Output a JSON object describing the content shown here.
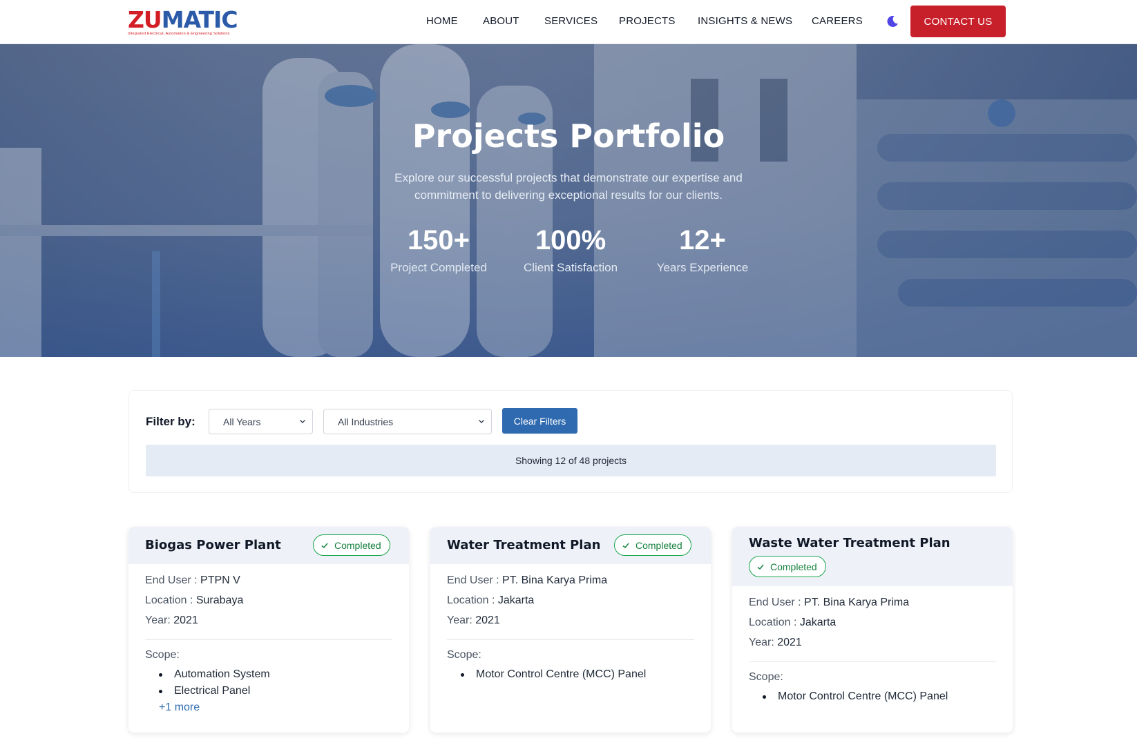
{
  "brand": {
    "logo_word_primary": "ZU",
    "logo_word_secondary": "MATIC",
    "logo_tagline": "Integrated Electrical, Automation & Engineering Solutions",
    "accent_red": "#c8202b",
    "accent_blue": "#2f6ab0"
  },
  "nav": {
    "items": [
      {
        "label": "HOME"
      },
      {
        "label": "ABOUT"
      },
      {
        "label": "SERVICES"
      },
      {
        "label": "PROJECTS"
      },
      {
        "label": "INSIGHTS & NEWS"
      },
      {
        "label": "CAREERS"
      }
    ],
    "theme_toggle_icon": "moon-icon",
    "contact_label": "CONTACT US"
  },
  "hero": {
    "title": "Projects Portfolio",
    "subtitle": "Explore our successful projects that demonstrate our expertise and commitment to delivering exceptional results for our clients.",
    "stats": [
      {
        "value": "150+",
        "label": "Project Completed"
      },
      {
        "value": "100%",
        "label": "Client Satisfaction"
      },
      {
        "value": "12+",
        "label": "Years Experience"
      }
    ]
  },
  "filters": {
    "label": "Filter by:",
    "year_selected": "All Years",
    "industry_selected": "All Industries",
    "clear_label": "Clear Filters",
    "results_text": "Showing 12 of 48 projects"
  },
  "projects": [
    {
      "title": "Biogas Power Plant",
      "status": "Completed",
      "end_user_label": "End User :",
      "end_user": "PTPN V",
      "location_label": "Location :",
      "location": "Surabaya",
      "year_label": "Year:",
      "year": "2021",
      "scope_label": "Scope:",
      "scope": [
        "Automation System",
        "Electrical Panel"
      ],
      "more_label": "+1 more"
    },
    {
      "title": "Water Treatment Plan",
      "status": "Completed",
      "end_user_label": "End User :",
      "end_user": "PT. Bina Karya Prima",
      "location_label": "Location :",
      "location": "Jakarta",
      "year_label": "Year:",
      "year": "2021",
      "scope_label": "Scope:",
      "scope": [
        "Motor Control Centre (MCC) Panel"
      ]
    },
    {
      "title": "Waste Water Treatment Plan",
      "status": "Completed",
      "end_user_label": "End User :",
      "end_user": "PT. Bina Karya Prima",
      "location_label": "Location :",
      "location": "Jakarta",
      "year_label": "Year:",
      "year": "2021",
      "scope_label": "Scope:",
      "scope": [
        "Motor Control Centre (MCC) Panel"
      ]
    }
  ]
}
